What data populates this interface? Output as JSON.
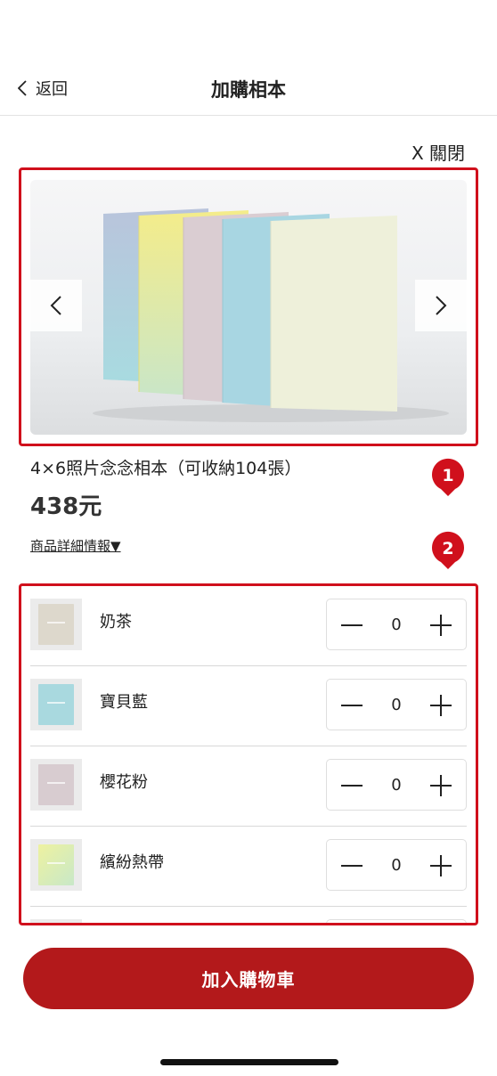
{
  "nav": {
    "back_label": "返回",
    "title": "加購相本"
  },
  "close_label": "X 關閉",
  "product": {
    "name": "4×6照片念念相本（可收納104張）",
    "price": "438元",
    "detail_link": "商品詳細情報▼"
  },
  "badges": [
    "1",
    "2"
  ],
  "options": [
    {
      "name": "奶茶",
      "qty": "0",
      "color": "#ddd8cc"
    },
    {
      "name": "寶貝藍",
      "qty": "0",
      "color": "#a9d9df"
    },
    {
      "name": "櫻花粉",
      "qty": "0",
      "color": "#d8ccd0"
    },
    {
      "name": "繽紛熱帶",
      "qty": "0",
      "color": "#e6eea0"
    }
  ],
  "cart_button": "加入購物車",
  "colors": {
    "accent": "#b3191b",
    "highlight": "#d0101c"
  }
}
